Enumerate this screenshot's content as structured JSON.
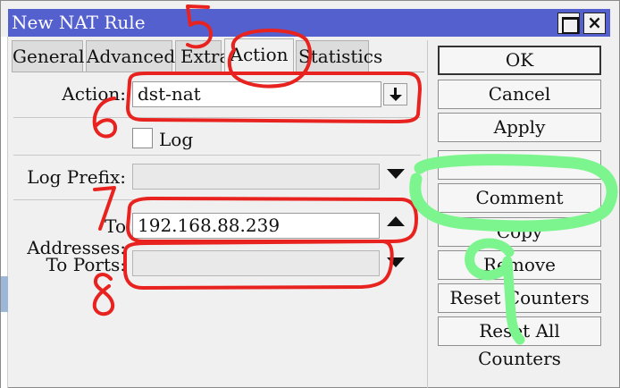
{
  "window": {
    "title": "New NAT Rule",
    "title_bar_color": "#5560cf",
    "maximize_icon": "maximize-icon",
    "close_icon": "close-icon",
    "close_glyph": "×"
  },
  "tabs": [
    {
      "label": "General",
      "active": false
    },
    {
      "label": "Advanced",
      "active": false
    },
    {
      "label": "Extra",
      "active": false
    },
    {
      "label": "Action",
      "active": true
    },
    {
      "label": "Statistics",
      "active": false
    }
  ],
  "form": {
    "action_label": "Action:",
    "action_value": "dst-nat",
    "log_label": "Log",
    "log_checked": false,
    "log_prefix_label": "Log Prefix:",
    "log_prefix_value": "",
    "to_addresses_label": "To Addresses:",
    "to_addresses_value": "192.168.88.239",
    "to_ports_label": "To Ports:",
    "to_ports_value": ""
  },
  "buttons": {
    "ok": "OK",
    "cancel": "Cancel",
    "apply": "Apply",
    "disable": "",
    "comment": "Comment",
    "copy": "Copy",
    "remove": "Remove",
    "reset_counters": "Reset Counters",
    "reset_all_counters": "Reset All Counters"
  },
  "annotations": {
    "red_color": "#e8231f",
    "green_color": "#7df58f",
    "step_numbers": [
      "5",
      "6",
      "7",
      "8",
      "9"
    ]
  }
}
